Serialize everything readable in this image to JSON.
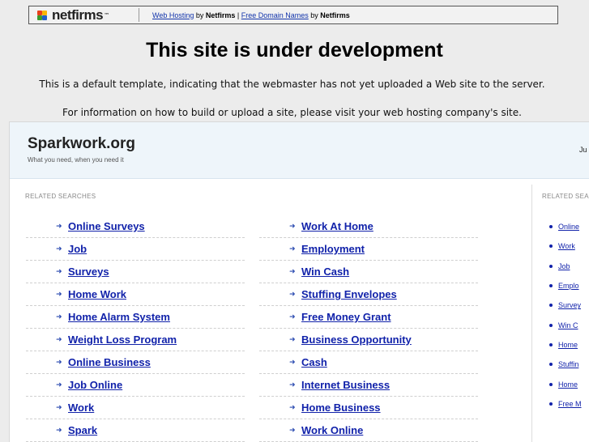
{
  "banner": {
    "logo_text": "netfirms",
    "logo_tm": "™",
    "link1": "Web Hosting",
    "by1": " by ",
    "brand1": "Netfirms",
    "sep": " | ",
    "link2": "Free Domain Names",
    "by2": " by ",
    "brand2": "Netfirms",
    "logo_colors": [
      "#e8401c",
      "#f7b500",
      "#3a9b2c",
      "#1f5fc7"
    ]
  },
  "headline": "This site is under development",
  "description_1": "This is a default template, indicating that the webmaster has not yet uploaded a Web site to the server.",
  "description_2": "For information on how to build or upload a site, please visit your web hosting company's site.",
  "site": {
    "name": "Sparkwork.org",
    "tagline": "What you need, when you need it",
    "header_right": "Ju"
  },
  "main_label": "RELATED SEARCHES",
  "side_label": "RELATED SEA",
  "arrow_glyph": "➜",
  "left_links": [
    "Online Surveys",
    "Job",
    "Surveys",
    "Home Work",
    "Home Alarm System",
    "Weight Loss Program",
    "Online Business",
    "Job Online",
    "Work",
    "Spark"
  ],
  "right_links": [
    "Work At Home",
    "Employment",
    "Win Cash",
    "Stuffing Envelopes",
    "Free Money Grant",
    "Business Opportunity",
    "Cash",
    "Internet Business",
    "Home Business",
    "Work Online"
  ],
  "side_links": [
    "Online",
    "Work",
    "Job",
    "Emplo",
    "Survey",
    "Win C",
    "Home",
    "Stuffin",
    "Home",
    "Free M"
  ]
}
